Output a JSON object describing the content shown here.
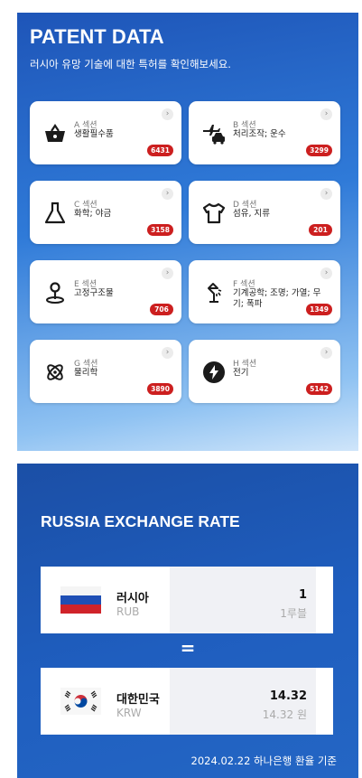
{
  "patent": {
    "title": "PATENT DATA",
    "subtitle": "러시아 유망 기술에 대한 특허를 확인해보세요.",
    "sections": [
      {
        "section": "A 섹션",
        "desc": "생활필수품",
        "count": "6431",
        "icon": "shopping-basket-icon"
      },
      {
        "section": "B 섹션",
        "desc": "처리조작; 운수",
        "count": "3299",
        "icon": "airplane-car-icon"
      },
      {
        "section": "C 섹션",
        "desc": "화학; 야금",
        "count": "3158",
        "icon": "flask-icon"
      },
      {
        "section": "D 섹션",
        "desc": "섬유, 지류",
        "count": "201",
        "icon": "shirt-icon"
      },
      {
        "section": "E 섹션",
        "desc": "고정구조물",
        "count": "706",
        "icon": "location-pin-icon"
      },
      {
        "section": "F 섹션",
        "desc": "기계공학; 조명; 가열; 무기; 폭파",
        "count": "1349",
        "icon": "desk-lamp-icon"
      },
      {
        "section": "G 섹션",
        "desc": "물리학",
        "count": "3890",
        "icon": "atom-icon"
      },
      {
        "section": "H 섹션",
        "desc": "전기",
        "count": "5142",
        "icon": "lightning-icon"
      }
    ],
    "chevron": "›"
  },
  "exchange": {
    "title": "RUSSIA EXCHANGE RATE",
    "from": {
      "country": "러시아",
      "code": "RUB",
      "amount": "1",
      "unit": "1루블"
    },
    "equals": "=",
    "to": {
      "country": "대한민국",
      "code": "KRW",
      "amount": "14.32",
      "unit": "14.32 원"
    },
    "note": "2024.02.22 하나은행 환율 기준"
  },
  "colors": {
    "accent": "#1e55b8",
    "badge": "#cc1f1f"
  }
}
